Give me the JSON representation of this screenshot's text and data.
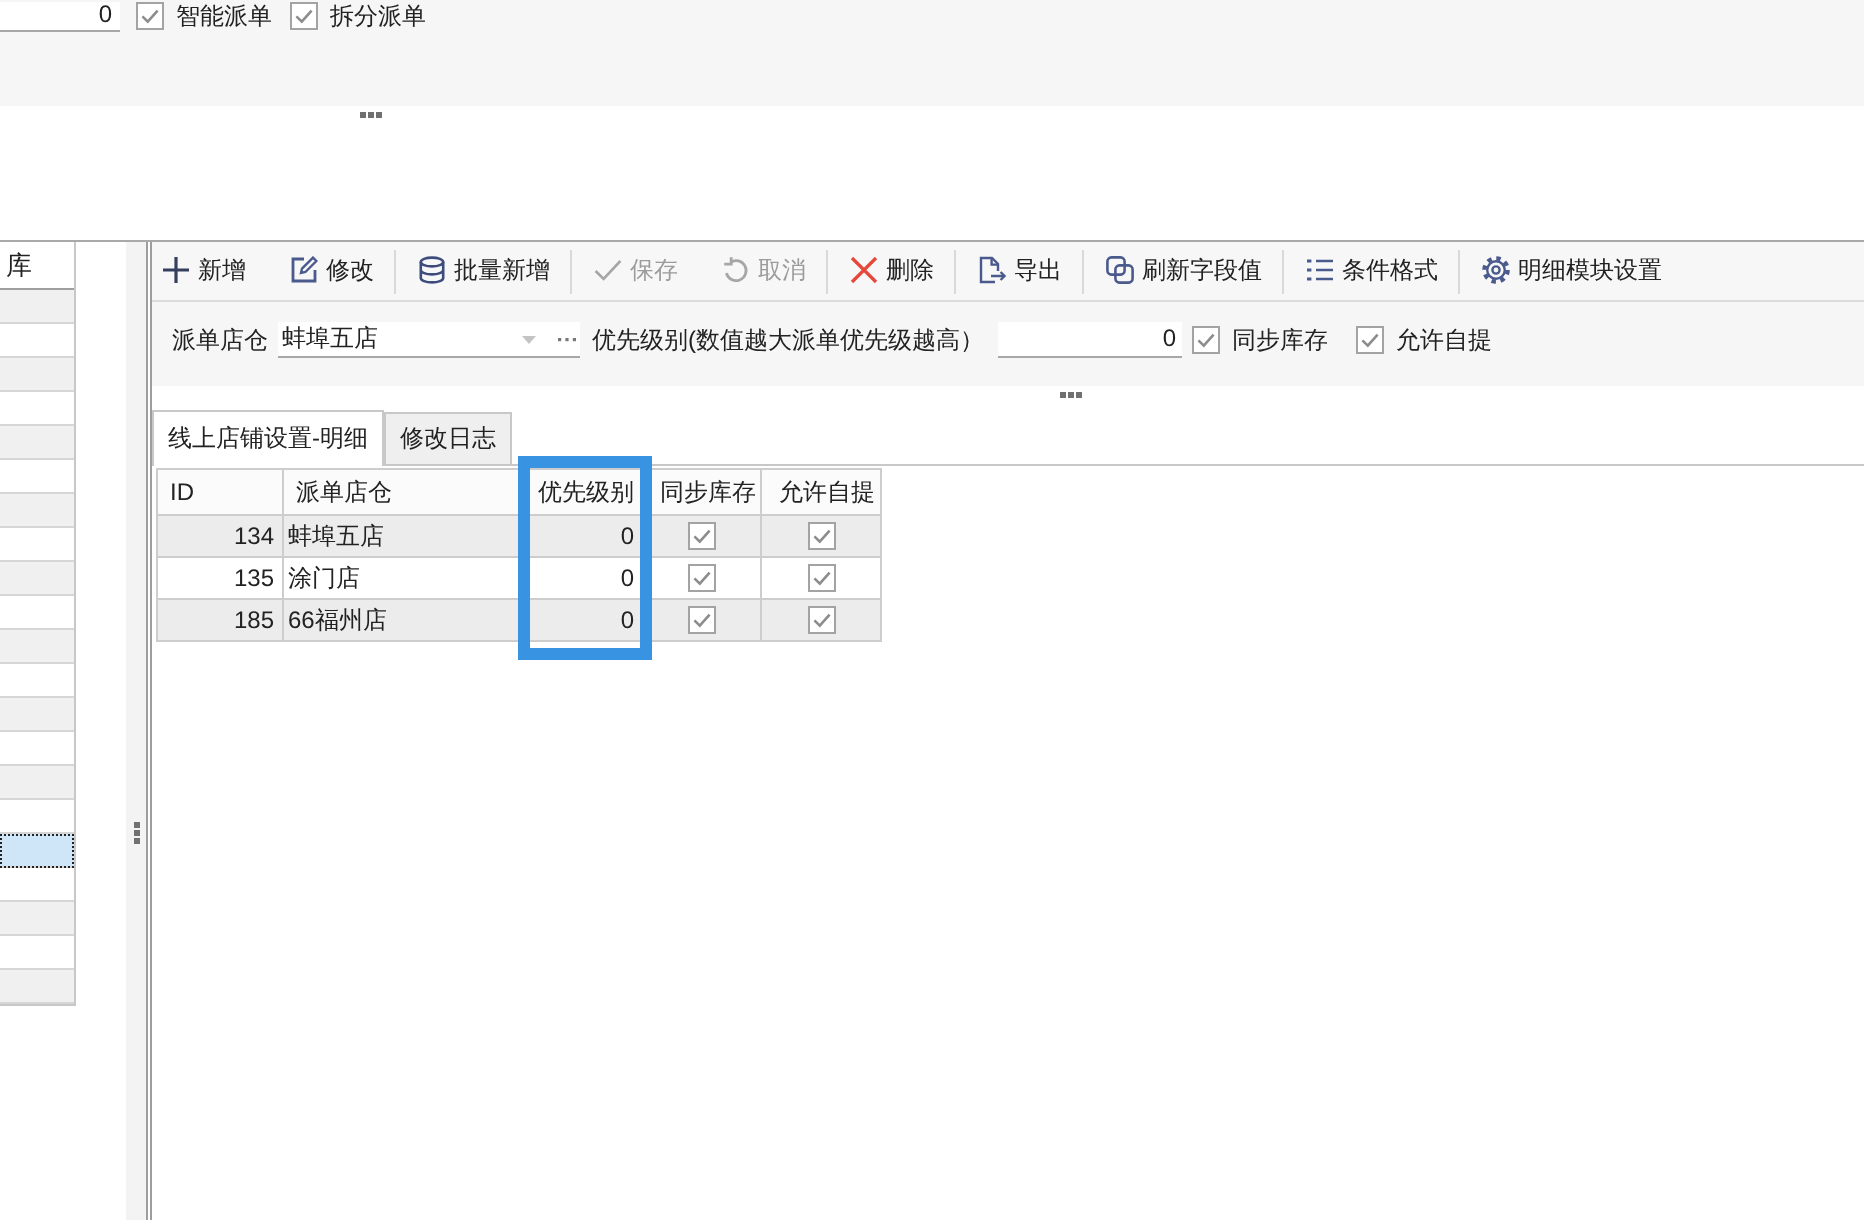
{
  "top_form": {
    "field": {
      "value": "0"
    },
    "checkboxes": [
      {
        "label": "智能派单",
        "checked": true
      },
      {
        "label": "拆分派单",
        "checked": true
      }
    ]
  },
  "left_grid": {
    "header": "库",
    "rows": [
      {
        "selected": false
      },
      {
        "selected": false
      },
      {
        "selected": false
      },
      {
        "selected": false
      },
      {
        "selected": false
      },
      {
        "selected": false
      },
      {
        "selected": false
      },
      {
        "selected": false
      },
      {
        "selected": false
      },
      {
        "selected": false
      },
      {
        "selected": false
      },
      {
        "selected": false
      },
      {
        "selected": false
      },
      {
        "selected": false
      },
      {
        "selected": false
      },
      {
        "selected": false
      },
      {
        "selected": true
      },
      {
        "selected": false
      },
      {
        "selected": false
      },
      {
        "selected": false
      },
      {
        "selected": false
      }
    ]
  },
  "toolbar": {
    "groups": [
      [
        {
          "kind": "add",
          "label": "新增",
          "disabled": false
        },
        {
          "kind": "edit",
          "label": "修改",
          "disabled": false
        }
      ],
      [
        {
          "kind": "batch-add",
          "label": "批量新增",
          "disabled": false
        }
      ],
      [
        {
          "kind": "save",
          "label": "保存",
          "disabled": true
        },
        {
          "kind": "undo",
          "label": "取消",
          "disabled": true
        }
      ],
      [
        {
          "kind": "delete",
          "label": "删除",
          "disabled": false
        }
      ],
      [
        {
          "kind": "export",
          "label": "导出",
          "disabled": false
        }
      ],
      [
        {
          "kind": "refresh",
          "label": "刷新字段值",
          "disabled": false
        }
      ],
      [
        {
          "kind": "format",
          "label": "条件格式",
          "disabled": false
        }
      ],
      [
        {
          "kind": "settings",
          "label": "明细模块设置",
          "disabled": false
        }
      ]
    ]
  },
  "form": {
    "store_label": "派单店仓",
    "store_field": {
      "value": "蚌埠五店"
    },
    "priority_label": "优先级别(数值越大派单优先级越高）",
    "priority_field": {
      "value": "0"
    },
    "checkboxes": [
      {
        "label": "同步库存",
        "checked": true
      },
      {
        "label": "允许自提",
        "checked": true
      }
    ]
  },
  "tabs": [
    {
      "label": "线上店铺设置-明细",
      "selected": true
    },
    {
      "label": "修改日志",
      "selected": false
    }
  ],
  "grid": {
    "columns": [
      {
        "label": "ID",
        "highlighted": false
      },
      {
        "label": "派单店仓",
        "highlighted": false
      },
      {
        "label": "优先级别",
        "highlighted": true
      },
      {
        "label": "同步库存",
        "highlighted": false
      },
      {
        "label": "允许自提",
        "highlighted": false
      }
    ],
    "rows": [
      {
        "id": "134",
        "store": "蚌埠五店",
        "priority": "0",
        "sync_stock": true,
        "allow_pickup": true
      },
      {
        "id": "135",
        "store": "涂门店",
        "priority": "0",
        "sync_stock": true,
        "allow_pickup": true
      },
      {
        "id": "185",
        "store": "66福州店",
        "priority": "0",
        "sync_stock": true,
        "allow_pickup": true
      }
    ]
  }
}
